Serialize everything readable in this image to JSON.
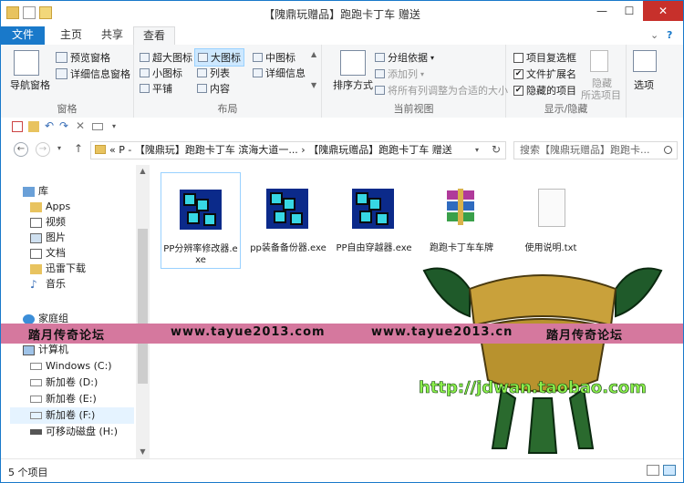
{
  "window": {
    "title": "【隗鼎玩赠品】跑跑卡丁车 赠送"
  },
  "tabs": {
    "file": "文件",
    "home": "主页",
    "share": "共享",
    "view": "查看"
  },
  "ribbon": {
    "pane": {
      "nav_pane": "导航窗格",
      "preview_pane": "预览窗格",
      "details_pane": "详细信息窗格",
      "label": "窗格"
    },
    "layout": {
      "extra_large": "超大图标",
      "large": "大图标",
      "medium": "中图标",
      "small": "小图标",
      "list": "列表",
      "details": "详细信息",
      "tiles": "平铺",
      "content": "内容",
      "label": "布局"
    },
    "current_view": {
      "sort_by": "排序方式",
      "group_by": "分组依据",
      "add_column": "添加列",
      "fit_columns": "将所有列调整为合适的大小",
      "label": "当前视图"
    },
    "show_hide": {
      "item_checkboxes": "项目复选框",
      "file_extensions": "文件扩展名",
      "hidden_items": "隐藏的项目",
      "hide_selected": "隐藏",
      "hide_selected_2": "所选项目",
      "label": "显示/隐藏",
      "item_checkboxes_checked": false,
      "file_extensions_checked": true,
      "hidden_items_checked": true
    },
    "options": "选项"
  },
  "address": {
    "path": "« P - 【隗鼎玩】跑跑卡丁车 滨海大道一...  ›  【隗鼎玩赠品】跑跑卡丁车 赠送",
    "search_placeholder": "搜索【隗鼎玩赠品】跑跑卡..."
  },
  "nav": {
    "library": "库",
    "apps": "Apps",
    "videos": "视频",
    "pictures": "图片",
    "documents": "文档",
    "thunder": "迅雷下载",
    "music": "音乐",
    "homegroup": "家庭组",
    "computer": "计算机",
    "drive_c": "Windows (C:)",
    "drive_d": "新加卷 (D:)",
    "drive_e": "新加卷 (E:)",
    "drive_f": "新加卷 (F:)",
    "drive_h": "可移动磁盘 (H:)"
  },
  "files": [
    {
      "name": "PP分辨率修改器.exe"
    },
    {
      "name": "pp装备备份器.exe"
    },
    {
      "name": "PP自由穿越器.exe"
    },
    {
      "name": "跑跑卡丁车车牌"
    },
    {
      "name": "使用说明.txt"
    }
  ],
  "status": {
    "count": "5 个项目"
  },
  "watermark": {
    "forum_left": "踏月传奇论坛",
    "url_left": "www.tayue2013.com",
    "url_right": "www.tayue2013.cn",
    "forum_right": "踏月传奇论坛",
    "shop_url": "http://jdwan.taobao.com"
  },
  "colors": {
    "accent": "#1979ca",
    "close": "#c7302b",
    "selection": "#cde8ff",
    "watermark_band": "#d5789e"
  }
}
